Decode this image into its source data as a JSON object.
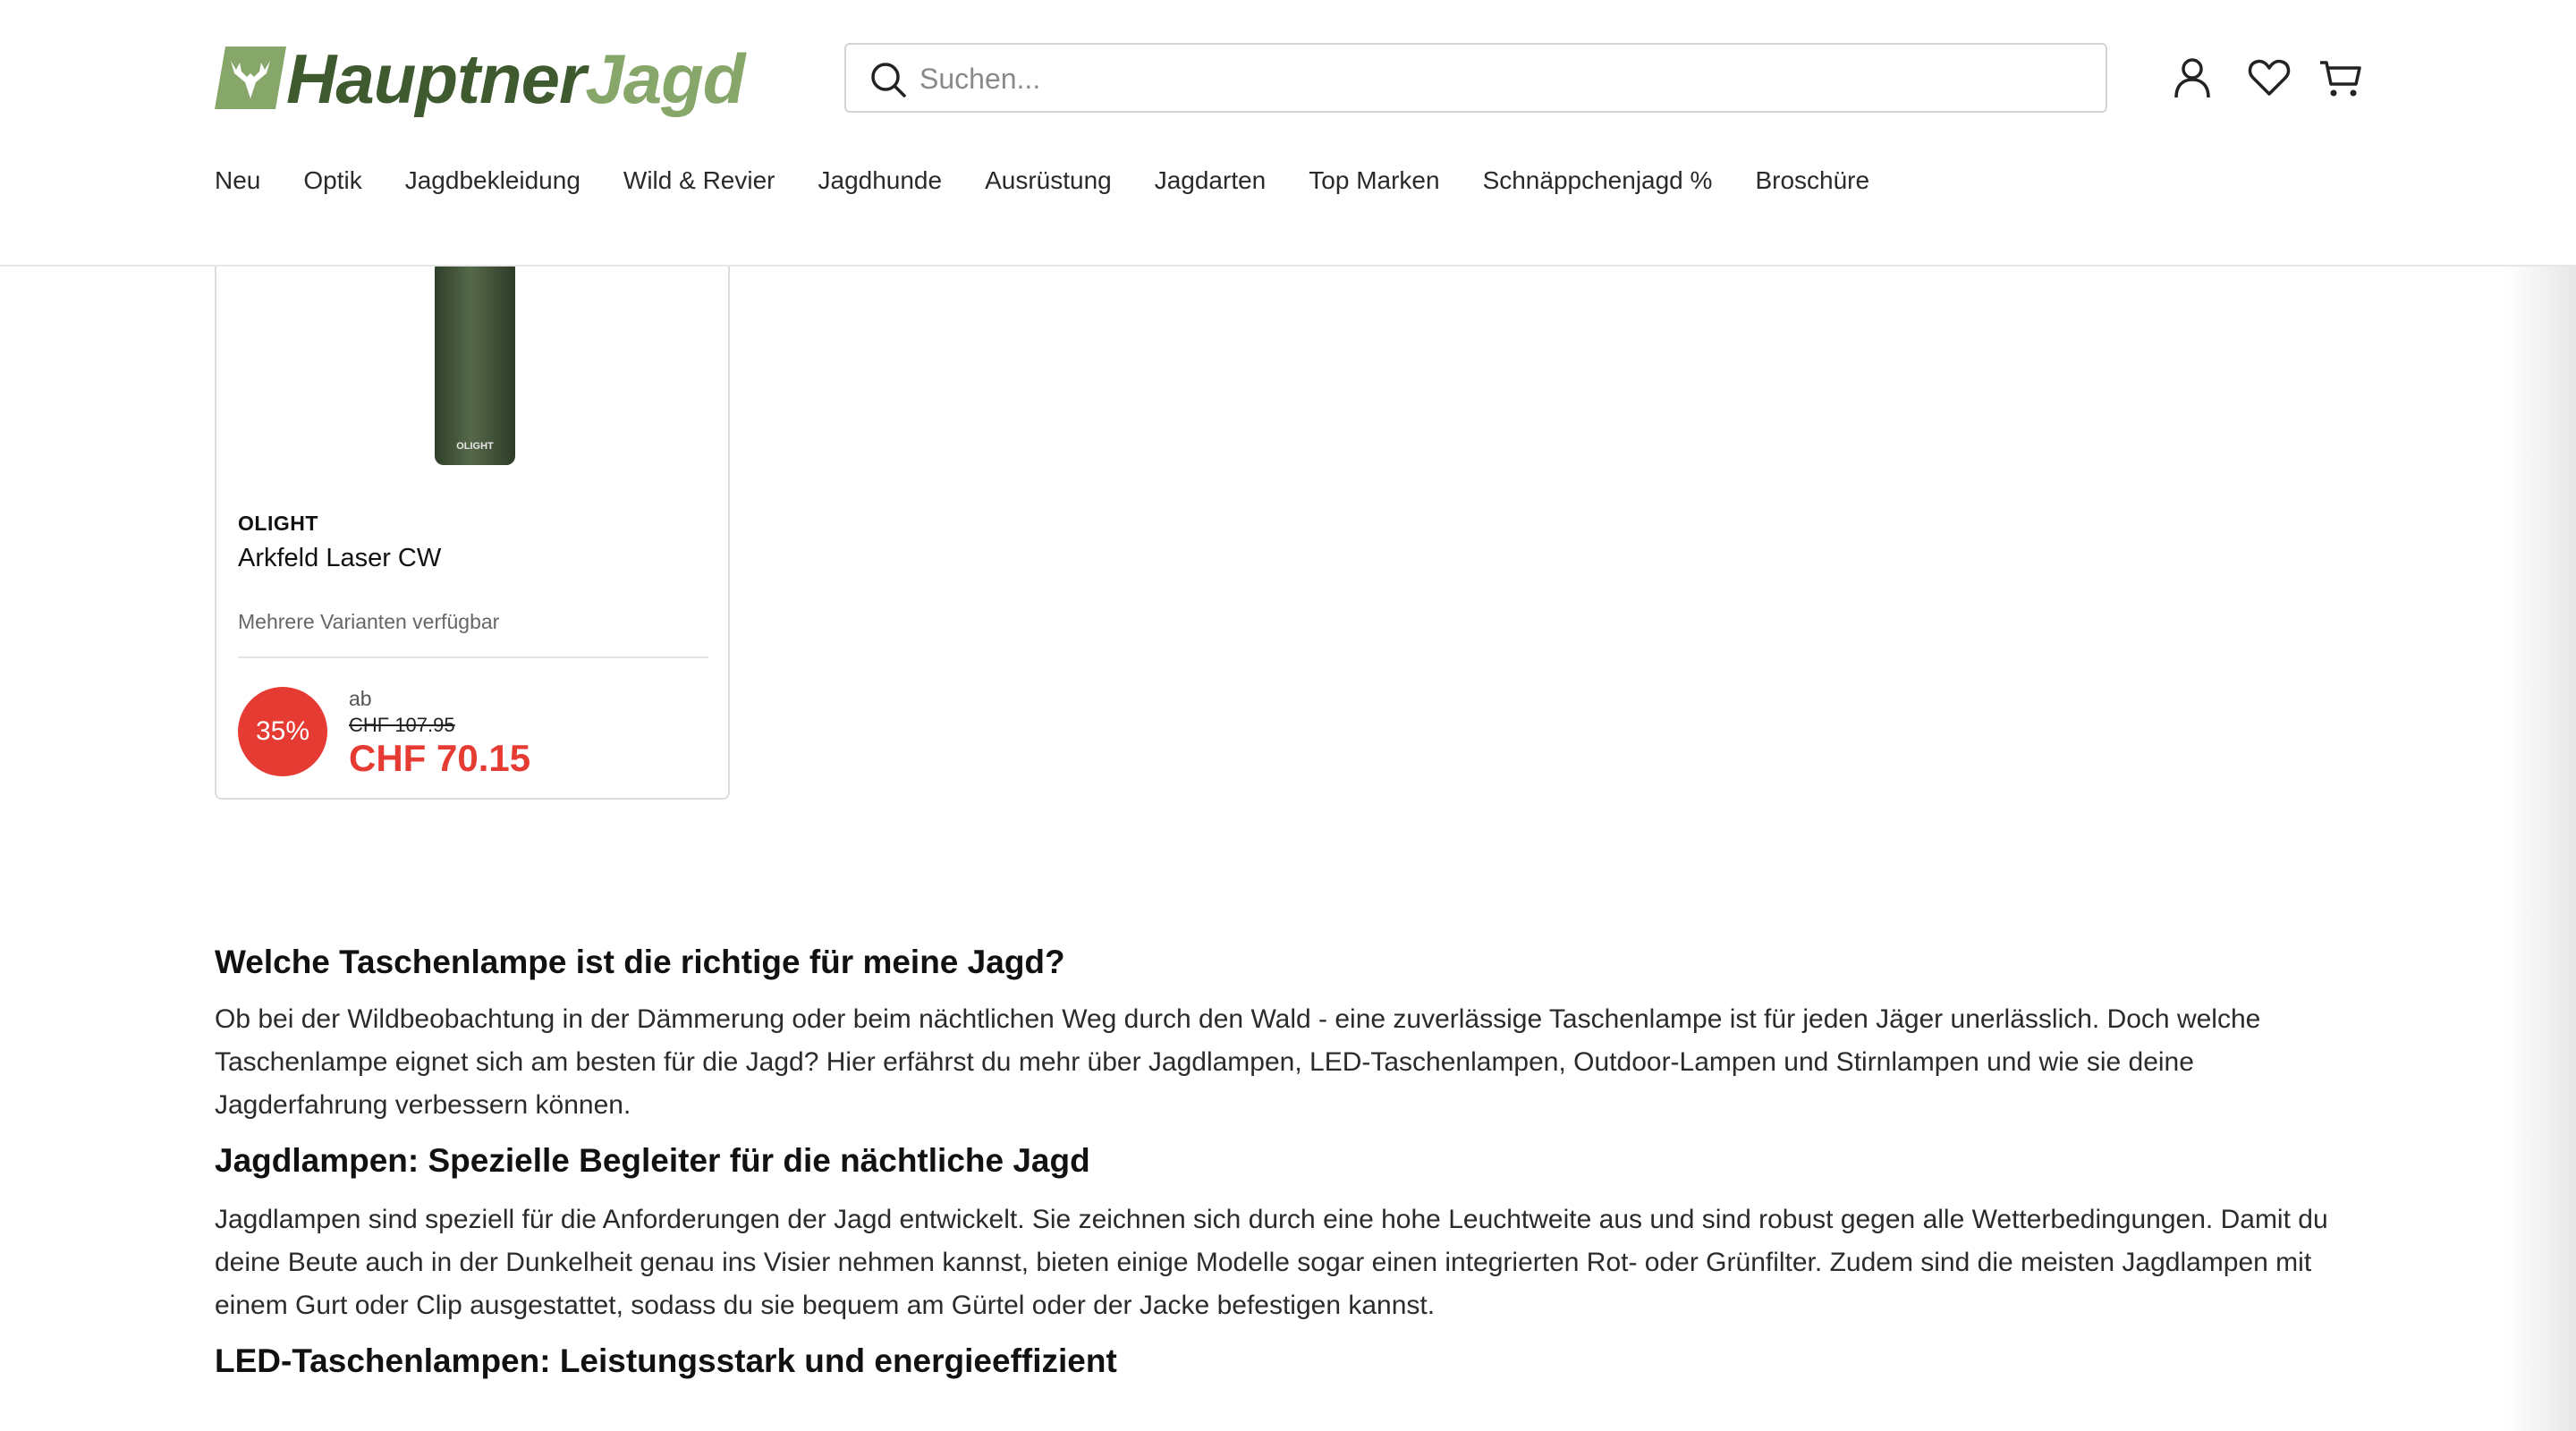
{
  "header": {
    "logo_text_part1": "Hauptner",
    "logo_text_part2": "Jagd",
    "search_placeholder": "Suchen...",
    "icons": [
      "user-icon",
      "heart-icon",
      "cart-icon"
    ],
    "brand_colors": {
      "dark_green": "#3f5a2f",
      "light_green": "#86a66a"
    }
  },
  "nav": {
    "items": [
      "Neu",
      "Optik",
      "Jagdbekleidung",
      "Wild & Revier",
      "Jagdhunde",
      "Ausrüstung",
      "Jagdarten",
      "Top Marken",
      "Schnäppchenjagd %",
      "Broschüre"
    ]
  },
  "product": {
    "brand": "OLIGHT",
    "name": "Arkfeld Laser CW",
    "variants": "Mehrere Varianten verfügbar",
    "discount": "35%",
    "price_prefix": "ab",
    "old_price": "CHF 107.95",
    "price": "CHF 70.15",
    "sale_color": "#e53b32",
    "image_label": "OLIGHT"
  },
  "article": {
    "h1": "Welche Taschenlampe ist die richtige für meine Jagd?",
    "p1": "Ob bei der Wildbeobachtung in der Dämmerung oder beim nächtlichen Weg durch den Wald - eine zuverlässige Taschenlampe ist für jeden Jäger unerlässlich. Doch welche Taschenlampe eignet sich am besten für die Jagd? Hier erfährst du mehr über Jagdlampen, LED-Taschenlampen, Outdoor-Lampen und Stirnlampen und wie sie deine Jagderfahrung verbessern können.",
    "h2": "Jagdlampen: Spezielle Begleiter für die nächtliche Jagd",
    "p2": "Jagdlampen sind speziell für die Anforderungen der Jagd entwickelt. Sie zeichnen sich durch eine hohe Leuchtweite aus und sind robust gegen alle Wetterbedingungen. Damit du deine Beute auch in der Dunkelheit genau ins Visier nehmen kannst, bieten einige Modelle sogar einen integrierten Rot- oder Grünfilter. Zudem sind die meisten Jagdlampen mit einem Gurt oder Clip ausgestattet, sodass du sie bequem am Gürtel oder der Jacke befestigen kannst.",
    "h3": "LED-Taschenlampen: Leistungsstark und energieeffizient"
  }
}
